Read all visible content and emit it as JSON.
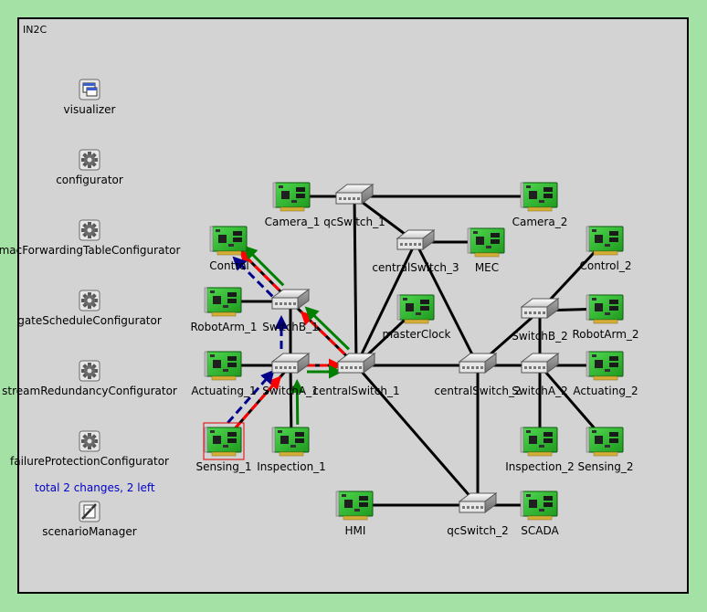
{
  "network_title": "IN2C",
  "status_text": "total 2 changes, 2 left",
  "colors": {
    "background": "#a4e1a4",
    "area": "#d3d3d3",
    "link": "#000000",
    "red_path": "#ff0000",
    "green_path": "#008000",
    "blue_path": "#00008b",
    "status": "#0000cc"
  },
  "modules": [
    {
      "id": "visualizer",
      "label": "visualizer",
      "icon": "visualizer-window-icon"
    },
    {
      "id": "configurator",
      "label": "configurator",
      "icon": "gear-icon"
    },
    {
      "id": "macForwardingTableConfigurator",
      "label": "macForwardingTableConfigurator",
      "icon": "gear-icon"
    },
    {
      "id": "gateScheduleConfigurator",
      "label": "gateScheduleConfigurator",
      "icon": "gear-icon"
    },
    {
      "id": "streamRedundancyConfigurator",
      "label": "streamRedundancyConfigurator",
      "icon": "gear-icon"
    },
    {
      "id": "failureProtectionConfigurator",
      "label": "failureProtectionConfigurator",
      "icon": "gear-icon"
    },
    {
      "id": "scenarioManager",
      "label": "scenarioManager",
      "icon": "scenario-manager-icon"
    }
  ],
  "nodes": [
    {
      "id": "Camera_1",
      "label": "Camera_1",
      "type": "host"
    },
    {
      "id": "Camera_2",
      "label": "Camera_2",
      "type": "host"
    },
    {
      "id": "qcSwitch_1",
      "label": "qcSwitch_1",
      "type": "switch"
    },
    {
      "id": "centralSwitch_3",
      "label": "centralSwitch_3",
      "type": "switch"
    },
    {
      "id": "MEC",
      "label": "MEC",
      "type": "host"
    },
    {
      "id": "Control",
      "label": "Control",
      "type": "host"
    },
    {
      "id": "Control_2",
      "label": "Control_2",
      "type": "host"
    },
    {
      "id": "RobotArm_1",
      "label": "RobotArm_1",
      "type": "host"
    },
    {
      "id": "SwitchB_1",
      "label": "SwitchB_1",
      "type": "switch"
    },
    {
      "id": "masterClock",
      "label": "masterClock",
      "type": "host"
    },
    {
      "id": "SwitchB_2",
      "label": "SwitchB_2",
      "type": "switch"
    },
    {
      "id": "RobotArm_2",
      "label": "RobotArm_2",
      "type": "host"
    },
    {
      "id": "Actuating_1",
      "label": "Actuating_1",
      "type": "host"
    },
    {
      "id": "SwitchA_1",
      "label": "SwitchA_1",
      "type": "switch"
    },
    {
      "id": "centralSwitch_1",
      "label": "centralSwitch_1",
      "type": "switch"
    },
    {
      "id": "centralSwitch_2",
      "label": "centralSwitch_2",
      "type": "switch"
    },
    {
      "id": "SwitchA_2",
      "label": "SwitchA_2",
      "type": "switch"
    },
    {
      "id": "Actuating_2",
      "label": "Actuating_2",
      "type": "host"
    },
    {
      "id": "Sensing_1",
      "label": "Sensing_1",
      "type": "host",
      "selected": true
    },
    {
      "id": "Inspection_1",
      "label": "Inspection_1",
      "type": "host"
    },
    {
      "id": "Inspection_2",
      "label": "Inspection_2",
      "type": "host"
    },
    {
      "id": "Sensing_2",
      "label": "Sensing_2",
      "type": "host"
    },
    {
      "id": "HMI",
      "label": "HMI",
      "type": "host"
    },
    {
      "id": "qcSwitch_2",
      "label": "qcSwitch_2",
      "type": "switch"
    },
    {
      "id": "SCADA",
      "label": "SCADA",
      "type": "host"
    }
  ],
  "links": [
    [
      "Camera_1",
      "qcSwitch_1"
    ],
    [
      "qcSwitch_1",
      "Camera_2"
    ],
    [
      "qcSwitch_1",
      "centralSwitch_3"
    ],
    [
      "qcSwitch_1",
      "centralSwitch_1"
    ],
    [
      "centralSwitch_3",
      "MEC"
    ],
    [
      "centralSwitch_3",
      "centralSwitch_1"
    ],
    [
      "centralSwitch_3",
      "centralSwitch_2"
    ],
    [
      "masterClock",
      "centralSwitch_1"
    ],
    [
      "centralSwitch_1",
      "SwitchB_1"
    ],
    [
      "centralSwitch_1",
      "SwitchA_1"
    ],
    [
      "centralSwitch_1",
      "centralSwitch_2"
    ],
    [
      "centralSwitch_1",
      "qcSwitch_2"
    ],
    [
      "centralSwitch_2",
      "qcSwitch_2"
    ],
    [
      "centralSwitch_2",
      "SwitchB_2"
    ],
    [
      "centralSwitch_2",
      "SwitchA_2"
    ],
    [
      "SwitchB_1",
      "SwitchA_1"
    ],
    [
      "SwitchB_1",
      "RobotArm_1"
    ],
    [
      "SwitchB_1",
      "Control"
    ],
    [
      "SwitchA_1",
      "Actuating_1"
    ],
    [
      "SwitchA_1",
      "Sensing_1"
    ],
    [
      "SwitchA_1",
      "Inspection_1"
    ],
    [
      "SwitchB_2",
      "SwitchA_2"
    ],
    [
      "SwitchB_2",
      "Control_2"
    ],
    [
      "SwitchB_2",
      "RobotArm_2"
    ],
    [
      "SwitchA_2",
      "Actuating_2"
    ],
    [
      "SwitchA_2",
      "Inspection_2"
    ],
    [
      "SwitchA_2",
      "Sensing_2"
    ],
    [
      "qcSwitch_2",
      "HMI"
    ],
    [
      "qcSwitch_2",
      "SCADA"
    ]
  ],
  "paths": [
    {
      "id": "red-stream-path",
      "color": "red",
      "style": "dashed",
      "hops": [
        "Sensing_1",
        "SwitchA_1",
        "centralSwitch_1",
        "SwitchB_1",
        "Control"
      ]
    },
    {
      "id": "green-stream-path",
      "color": "green",
      "style": "solid",
      "hops": [
        "Inspection_1",
        "SwitchA_1",
        "centralSwitch_1",
        "SwitchB_1",
        "Control"
      ]
    },
    {
      "id": "blue-stream-path",
      "color": "blue",
      "style": "dashed",
      "hops": [
        "Sensing_1",
        "SwitchA_1",
        "SwitchB_1",
        "Control"
      ]
    }
  ]
}
